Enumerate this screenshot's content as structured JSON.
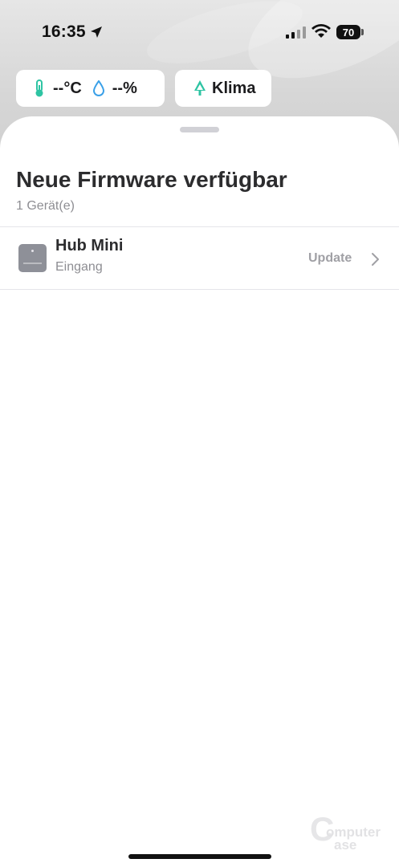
{
  "status_bar": {
    "time": "16:35",
    "battery_level": "70",
    "icons": [
      "location-arrow-icon",
      "cellular-signal-icon",
      "wifi-icon",
      "battery-icon"
    ]
  },
  "chips": {
    "temperature": "--°C",
    "humidity": "--%",
    "klima_label": "Klima",
    "accent_color": "#2ec4a3"
  },
  "sheet": {
    "title": "Neue Firmware verfügbar",
    "subtitle": "1 Gerät(e)"
  },
  "devices": [
    {
      "name": "Hub Mini",
      "room": "Eingang",
      "action_label": "Update"
    }
  ],
  "watermark": {
    "line1": "omputer",
    "line2": "ase"
  }
}
